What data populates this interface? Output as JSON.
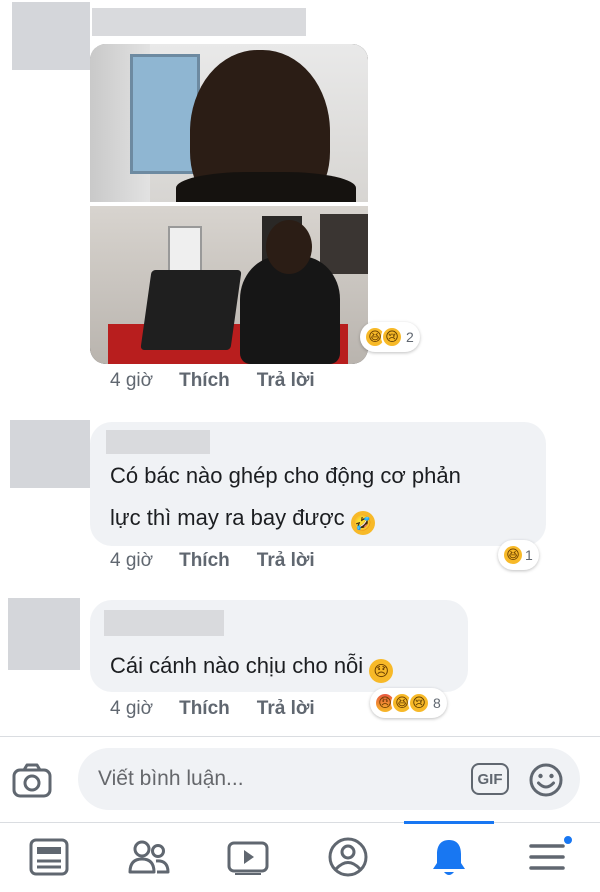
{
  "comments": [
    {
      "kind": "image",
      "reactions": {
        "emojis": [
          "haha",
          "sad"
        ],
        "count": "2"
      },
      "meta": {
        "time": "4 giờ",
        "like": "Thích",
        "reply": "Trả lời"
      }
    },
    {
      "kind": "text",
      "text_line1": "Có bác nào ghép cho động cơ phản",
      "text_line2": "lực thì may ra bay được",
      "text_emoji": "rofl",
      "reactions": {
        "emojis": [
          "haha"
        ],
        "count": "1"
      },
      "meta": {
        "time": "4 giờ",
        "like": "Thích",
        "reply": "Trả lời"
      }
    },
    {
      "kind": "text",
      "text_line1": "Cái cánh nào chịu cho nỗi",
      "text_emoji": "disappointed",
      "reactions": {
        "emojis": [
          "angry",
          "haha",
          "sad"
        ],
        "count": "8"
      },
      "meta": {
        "time": "4 giờ",
        "like": "Thích",
        "reply": "Trả lời"
      }
    }
  ],
  "composer": {
    "placeholder": "Viết bình luận...",
    "gif_label": "GIF",
    "icons": [
      "camera-icon",
      "gif-icon",
      "emoji-icon"
    ]
  },
  "bottom_nav": {
    "items": [
      "news-feed-icon",
      "friends-icon",
      "watch-icon",
      "profile-icon",
      "notifications-icon",
      "menu-icon"
    ],
    "active": "notifications-icon"
  },
  "colors": {
    "accent": "#1877f2",
    "bubble": "#f0f2f5",
    "meta_text": "#606770",
    "reaction_yellow": "#f7b928"
  }
}
